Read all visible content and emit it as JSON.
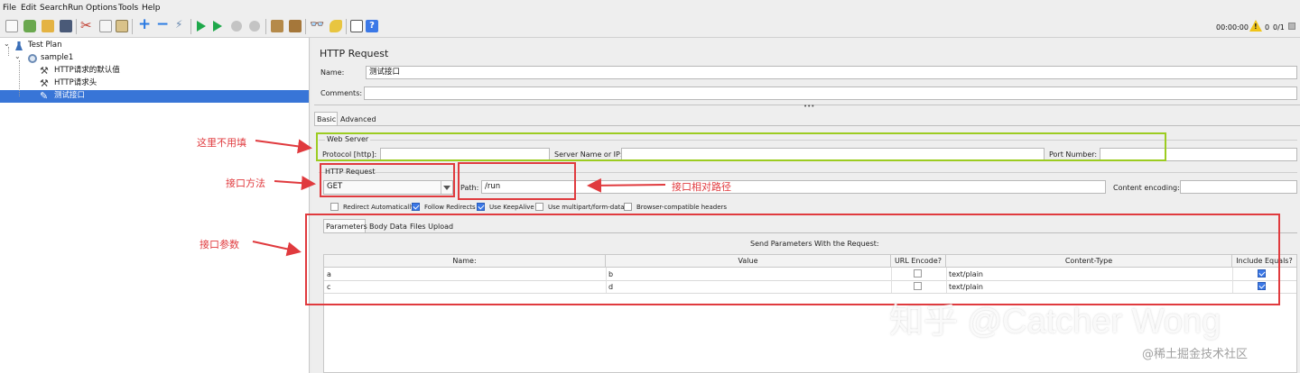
{
  "menu": [
    "File",
    "Edit",
    "Search",
    "Run",
    "Options",
    "Tools",
    "Help"
  ],
  "toolbar": {
    "timer": "00:00:00",
    "warning_count": "0",
    "threads": "0/1",
    "warning_color": "#f0c419"
  },
  "tree": {
    "items": [
      {
        "label": "Test Plan",
        "icon": "test-plan-icon"
      },
      {
        "label": "sample1",
        "icon": "thread-group-icon"
      },
      {
        "label": "HTTP请求的默认值",
        "icon": "config-element-icon"
      },
      {
        "label": "HTTP请求头",
        "icon": "config-element-icon"
      },
      {
        "label": "测试接口",
        "icon": "sampler-icon",
        "selected": true
      }
    ]
  },
  "panel": {
    "title": "HTTP Request",
    "name_label": "Name:",
    "name_value": "测试接口",
    "comments_label": "Comments:",
    "comments_value": "",
    "tabs": [
      "Basic",
      "Advanced"
    ],
    "web_server": {
      "legend": "Web Server",
      "protocol_label": "Protocol [http]:",
      "server_label": "Server Name or IP:",
      "port_label": "Port Number:"
    },
    "http_request": {
      "legend": "HTTP Request",
      "method": "GET",
      "path_label": "Path:",
      "path_value": "/run",
      "encoding_label": "Content encoding:"
    },
    "options": [
      {
        "label": "Redirect Automatically",
        "checked": false
      },
      {
        "label": "Follow Redirects",
        "checked": true
      },
      {
        "label": "Use KeepAlive",
        "checked": true
      },
      {
        "label": "Use multipart/form-data",
        "checked": false
      },
      {
        "label": "Browser-compatible headers",
        "checked": false
      }
    ],
    "param_tabs": [
      "Parameters",
      "Body Data",
      "Files Upload"
    ],
    "table_title": "Send Parameters With the Request:",
    "columns": [
      "Name:",
      "Value",
      "URL Encode?",
      "Content-Type",
      "Include Equals?"
    ],
    "rows": [
      {
        "name": "a",
        "value": "b",
        "url_encode": false,
        "content_type": "text/plain",
        "include_equals": true
      },
      {
        "name": "c",
        "value": "d",
        "url_encode": false,
        "content_type": "text/plain",
        "include_equals": true
      }
    ]
  },
  "annotations": {
    "web_server": "这里不用填",
    "method": "接口方法",
    "path": "接口相对路径",
    "params": "接口参数",
    "color": "#e03a3e"
  },
  "watermark": {
    "main": "知乎 @Catcher Wong",
    "corner": "@稀土掘金技术社区"
  }
}
